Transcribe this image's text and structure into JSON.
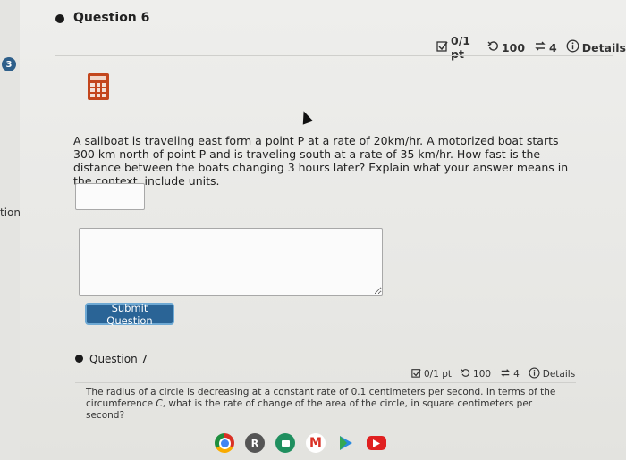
{
  "sidebar": {
    "badge_count": "3",
    "partial_label": "tion"
  },
  "question6": {
    "title": "Question 6",
    "score": "0/1 pt",
    "attempts": "100",
    "retakes": "4",
    "details_label": "Details",
    "text": "A sailboat is traveling east form a point P at a rate of 20km/hr. A motorized boat starts 300 km north of point P and is traveling south at a rate of 35 km/hr. How fast is the distance between the boats changing 3 hours later? Explain what your answer means in the context, include units.",
    "answer_value": "",
    "explanation_value": "",
    "submit_label": "Submit Question"
  },
  "question7": {
    "title": "Question 7",
    "score": "0/1 pt",
    "attempts": "100",
    "retakes": "4",
    "details_label": "Details",
    "text_before": "The radius of a circle is decreasing at a constant rate of 0.1 centimeters per second. In terms of the circumference ",
    "variable": "C",
    "text_after": ", what is the rate of change of the area of the circle, in square centimeters per second?"
  },
  "taskbar": {
    "apps": [
      {
        "name": "chrome",
        "color": "#e8a21a"
      },
      {
        "name": "profile",
        "label": "R",
        "color": "#555555"
      },
      {
        "name": "meet",
        "color": "#1f8f5f"
      },
      {
        "name": "gmail",
        "label": "M",
        "color": "#ffffff"
      },
      {
        "name": "play",
        "color": "#2a8be0"
      },
      {
        "name": "youtube",
        "color": "#e02020"
      }
    ]
  },
  "colors": {
    "accent": "#2a6496",
    "calc_icon": "#c3461d",
    "badge": "#2e5f8a"
  }
}
